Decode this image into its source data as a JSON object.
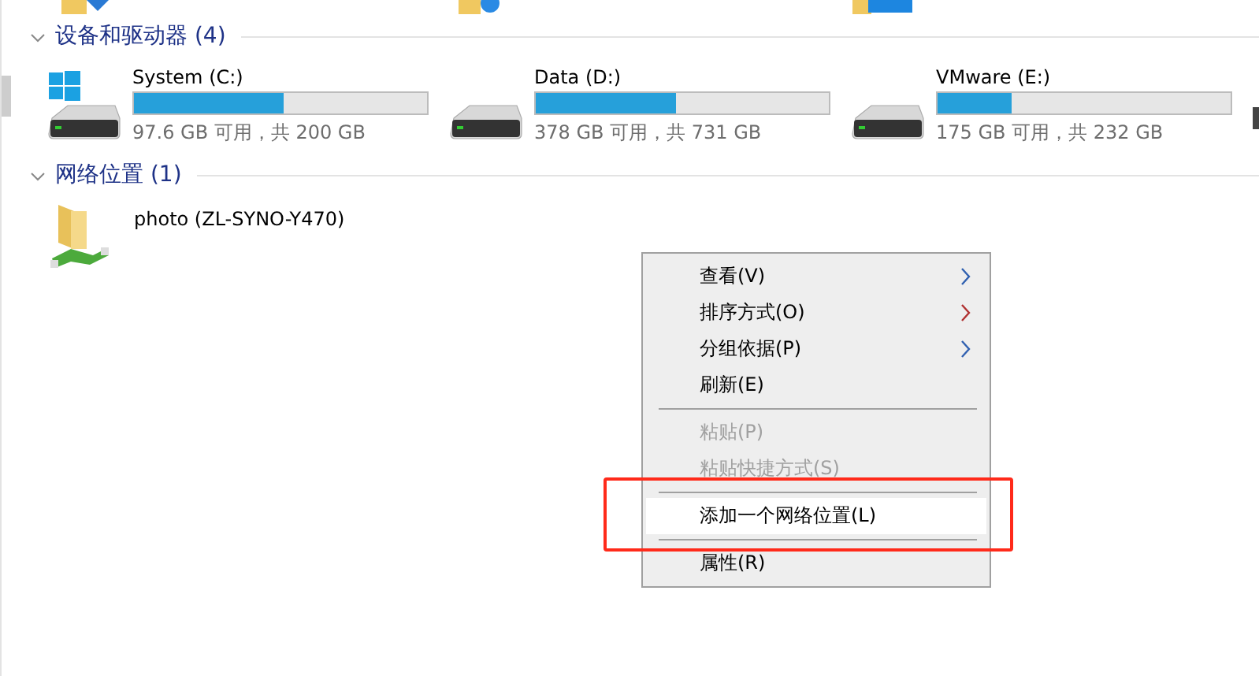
{
  "sections": [
    {
      "title": "设备和驱动器 (4)",
      "expanded": true,
      "kind": "drives",
      "items": [
        {
          "name": "System (C:)",
          "size": "97.6 GB 可用，共 200 GB",
          "level": 0.51,
          "kind": "system"
        },
        {
          "name": "Data (D:)",
          "size": "378 GB 可用，共 731 GB",
          "level": 0.48,
          "kind": "disk"
        },
        {
          "name": "VMware (E:)",
          "size": "175 GB 可用，共 232 GB",
          "level": 0.25,
          "kind": "disk"
        }
      ]
    },
    {
      "title": "网络位置 (1)",
      "expanded": true,
      "kind": "network",
      "items": [
        {
          "name": "photo (ZL-SYNO-Y470)"
        }
      ]
    }
  ],
  "context_menu": {
    "items": [
      {
        "kind": "item",
        "label": "查看(V)",
        "submenu": true,
        "disabled": false,
        "selected": false
      },
      {
        "kind": "item",
        "label": "排序方式(O)",
        "submenu": true,
        "disabled": false,
        "selected": false
      },
      {
        "kind": "item",
        "label": "分组依据(P)",
        "submenu": true,
        "disabled": false,
        "selected": false
      },
      {
        "kind": "item",
        "label": "刷新(E)",
        "submenu": false,
        "disabled": false,
        "selected": false
      },
      {
        "kind": "separator"
      },
      {
        "kind": "item",
        "label": "粘贴(P)",
        "submenu": false,
        "disabled": true,
        "selected": false
      },
      {
        "kind": "item",
        "label": "粘贴快捷方式(S)",
        "submenu": false,
        "disabled": true,
        "selected": false
      },
      {
        "kind": "separator"
      },
      {
        "kind": "item",
        "label": "添加一个网络位置(L)",
        "submenu": false,
        "disabled": false,
        "selected": true
      },
      {
        "kind": "separator"
      },
      {
        "kind": "item",
        "label": "属性(R)",
        "submenu": false,
        "disabled": false,
        "selected": false
      }
    ]
  }
}
